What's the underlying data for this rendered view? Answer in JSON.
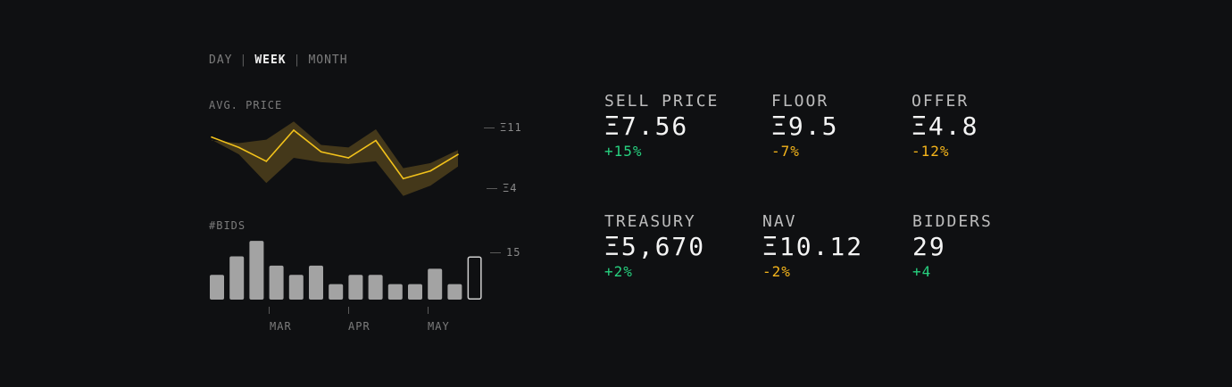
{
  "period_tabs": {
    "items": [
      {
        "label": "DAY",
        "active": false
      },
      {
        "label": "WEEK",
        "active": true
      },
      {
        "label": "MONTH",
        "active": false
      }
    ],
    "separator": "|"
  },
  "price_chart": {
    "label": "AVG. PRICE",
    "ticks": [
      "Ξ11",
      "Ξ4"
    ]
  },
  "bids_chart": {
    "label": "#BIDS",
    "tick": "15"
  },
  "months": [
    "MAR",
    "APR",
    "MAY"
  ],
  "stats": [
    {
      "name": "SELL PRICE",
      "value": "Ξ7.56",
      "delta": "+15%",
      "trend": "up"
    },
    {
      "name": "FLOOR",
      "value": "Ξ9.5",
      "delta": "-7%",
      "trend": "down"
    },
    {
      "name": "OFFER",
      "value": "Ξ4.8",
      "delta": "-12%",
      "trend": "down"
    },
    {
      "name": "TREASURY",
      "value": "Ξ5,670",
      "delta": "+2%",
      "trend": "up"
    },
    {
      "name": "NAV",
      "value": "Ξ10.12",
      "delta": "-2%",
      "trend": "down"
    },
    {
      "name": "BIDDERS",
      "value": "29",
      "delta": "+4",
      "trend": "up"
    }
  ],
  "colors": {
    "background": "#0f1012",
    "line": "#f2c21b",
    "band": "#4a3d1c",
    "bars": "#a3a3a3",
    "positive": "#27d17f",
    "negative": "#f5b51b"
  },
  "chart_data": [
    {
      "type": "area",
      "title": "AVG. PRICE",
      "ylim": [
        4,
        11
      ],
      "y_ticks": [
        "Ξ11",
        "Ξ4"
      ],
      "series": [
        {
          "values": [
            10.0,
            8.8,
            7.2,
            10.8,
            8.3,
            7.6,
            9.6,
            5.2,
            6.1,
            8.0
          ]
        }
      ],
      "band_upper": [
        9.6,
        9.3,
        9.7,
        11.8,
        9.1,
        8.8,
        10.9,
        6.4,
        7.0,
        8.5
      ],
      "band_lower": [
        9.7,
        8.0,
        4.7,
        7.6,
        7.1,
        6.9,
        7.2,
        3.2,
        4.4,
        6.6
      ]
    },
    {
      "type": "bar",
      "title": "#BIDS",
      "ylim": [
        0,
        15
      ],
      "values": [
        8,
        14,
        19,
        11,
        8,
        11,
        5,
        8,
        8,
        5,
        5,
        10,
        5,
        14
      ],
      "highlighted_index": 13,
      "x_ticks": [
        "MAR",
        "APR",
        "MAY"
      ]
    }
  ]
}
